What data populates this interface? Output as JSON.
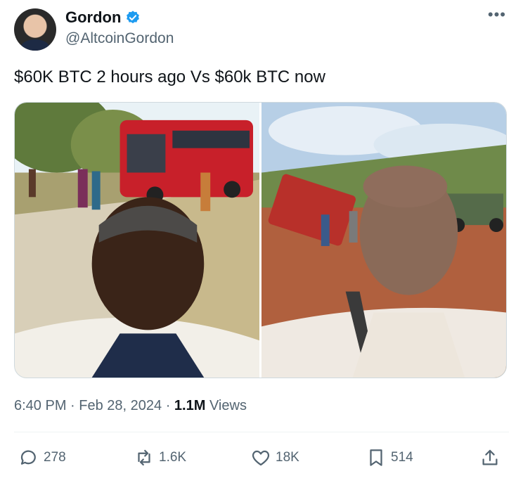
{
  "author": {
    "name": "Gordon",
    "handle": "@AltcoinGordon"
  },
  "tweet": {
    "text": "$60K BTC 2 hours ago Vs $60k BTC now"
  },
  "meta": {
    "time": "6:40 PM",
    "date": "Feb 28, 2024",
    "views_count": "1.1M",
    "views_label": "Views"
  },
  "actions": {
    "replies": "278",
    "reposts": "1.6K",
    "likes": "18K",
    "bookmarks": "514"
  },
  "colors": {
    "accent": "#1d9bf0",
    "muted": "#536471"
  }
}
